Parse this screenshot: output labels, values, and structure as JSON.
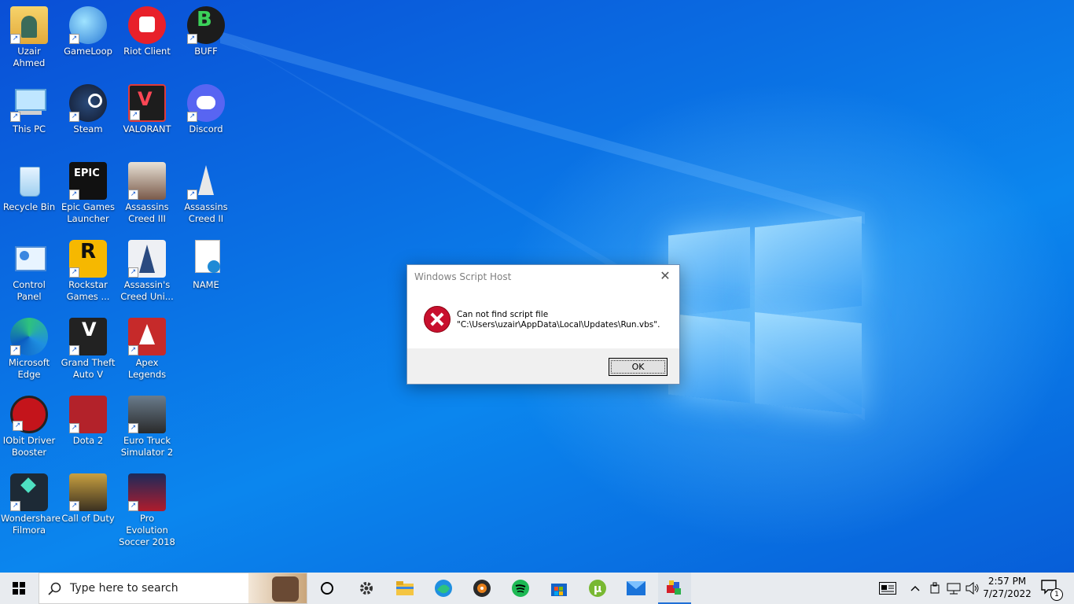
{
  "desktop": {
    "icons": [
      {
        "label": "Uzair Ahmed"
      },
      {
        "label": "GameLoop"
      },
      {
        "label": "Riot Client"
      },
      {
        "label": "BUFF"
      },
      {
        "label": "This PC"
      },
      {
        "label": "Steam"
      },
      {
        "label": "VALORANT"
      },
      {
        "label": "Discord"
      },
      {
        "label": "Recycle Bin"
      },
      {
        "label": "Epic Games Launcher"
      },
      {
        "label": "Assassins Creed III"
      },
      {
        "label": "Assassins Creed II"
      },
      {
        "label": "Control Panel"
      },
      {
        "label": "Rockstar Games ..."
      },
      {
        "label": "Assassin's Creed Uni..."
      },
      {
        "label": "NAME"
      },
      {
        "label": "Microsoft Edge"
      },
      {
        "label": "Grand Theft Auto V"
      },
      {
        "label": "Apex Legends"
      },
      {
        "label": "IObit Driver Booster"
      },
      {
        "label": "Dota 2"
      },
      {
        "label": "Euro Truck Simulator 2"
      },
      {
        "label": "Wondershare Filmora"
      },
      {
        "label": "Call of Duty"
      },
      {
        "label": "Pro Evolution Soccer 2018"
      }
    ]
  },
  "dialog": {
    "title": "Windows Script Host",
    "close": "✕",
    "line1": "Can not find script file",
    "line2": "\"C:\\Users\\uzair\\AppData\\Local\\Updates\\Run.vbs\".",
    "ok": "OK"
  },
  "taskbar": {
    "search_placeholder": "Type here to search",
    "time": "2:57 PM",
    "date": "7/27/2022",
    "notification_count": "1"
  },
  "colors": {
    "desktop_blue": "#0a6fe3",
    "error_red": "#c8102e",
    "taskbar": "#e8ebef"
  }
}
